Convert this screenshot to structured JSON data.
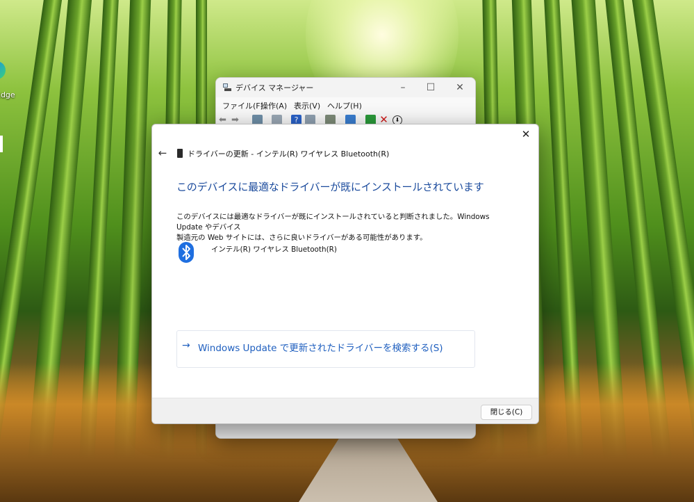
{
  "desktop": {
    "edge_label": "Edge"
  },
  "device_manager": {
    "title": "デバイス マネージャー",
    "menu": [
      "ファイル(F)",
      "操作(A)",
      "表示(V)",
      "ヘルプ(H)"
    ]
  },
  "dialog": {
    "header_title": "ドライバーの更新 - インテル(R) ワイヤレス Bluetooth(R)",
    "headline": "このデバイスに最適なドライバーが既にインストールされています",
    "description_line1": "このデバイスには最適なドライバーが既にインストールされていると判断されました。Windows Update やデバイス",
    "description_line2": "製造元の Web サイトには、さらに良いドライバーがある可能性があります。",
    "device_name": "インテル(R) ワイヤレス Bluetooth(R)",
    "search_link_arrow": "→",
    "search_link_label": "Windows Update で更新されたドライバーを検索する(S)",
    "close_button": "閉じる(C)"
  },
  "colors": {
    "headline": "#1a4a9c",
    "link": "#1f5fbf",
    "bluetooth": "#1f6fe0"
  }
}
